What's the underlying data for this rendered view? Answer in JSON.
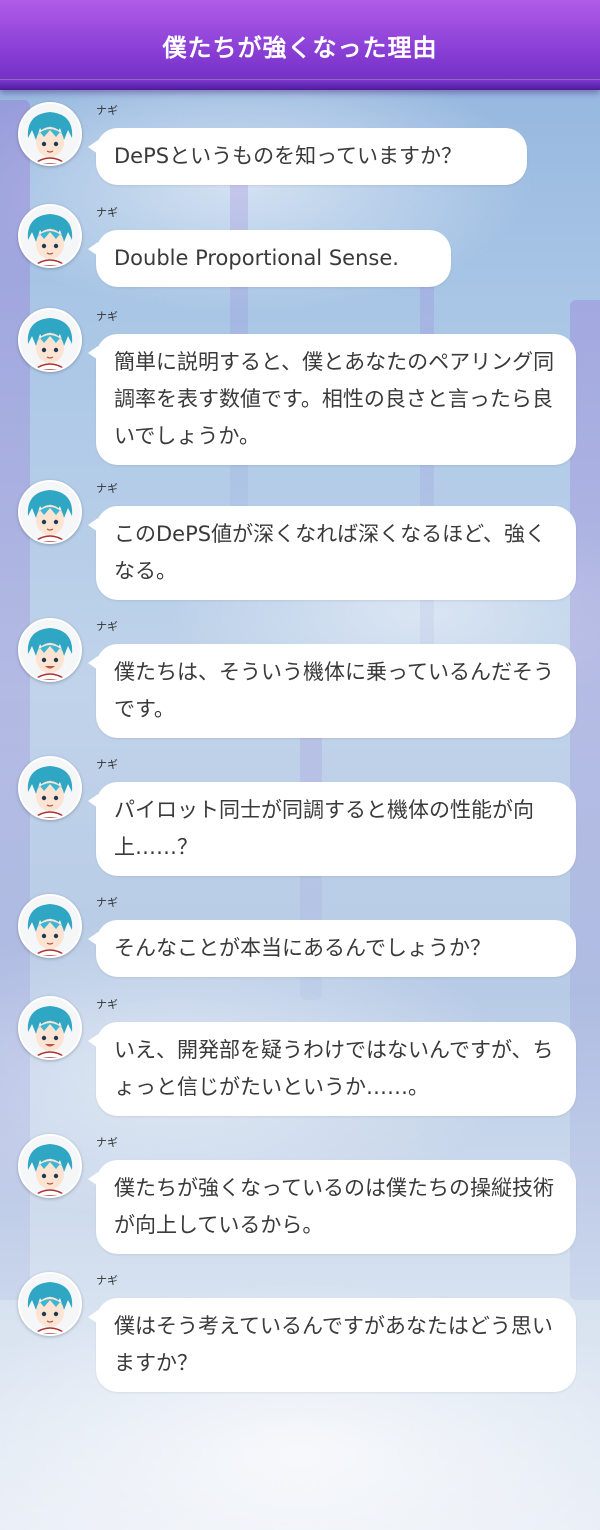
{
  "header": {
    "title": "僕たちが強くなった理由"
  },
  "speaker_name": "ナギ",
  "messages": [
    {
      "text": "DePSというものを知っていますか？"
    },
    {
      "text": "Double Proportional Sense."
    },
    {
      "text": "簡単に説明すると、僕とあなたのペアリング同調率を表す数値です。相性の良さと言ったら良いでしょうか。"
    },
    {
      "text": "このDePS値が深くなれば深くなるほど、強くなる。"
    },
    {
      "text": "僕たちは、そういう機体に乗っているんだそうです。"
    },
    {
      "text": "パイロット同士が同調すると機体の性能が向上……？"
    },
    {
      "text": "そんなことが本当にあるんでしょうか？"
    },
    {
      "text": "いえ、開発部を疑うわけではないんですが、ちょっと信じがたいというか……。"
    },
    {
      "text": "僕たちが強くなっているのは僕たちの操縦技術が向上しているから。"
    },
    {
      "text": "僕はそう考えているんですがあなたはどう思いますか？"
    }
  ]
}
